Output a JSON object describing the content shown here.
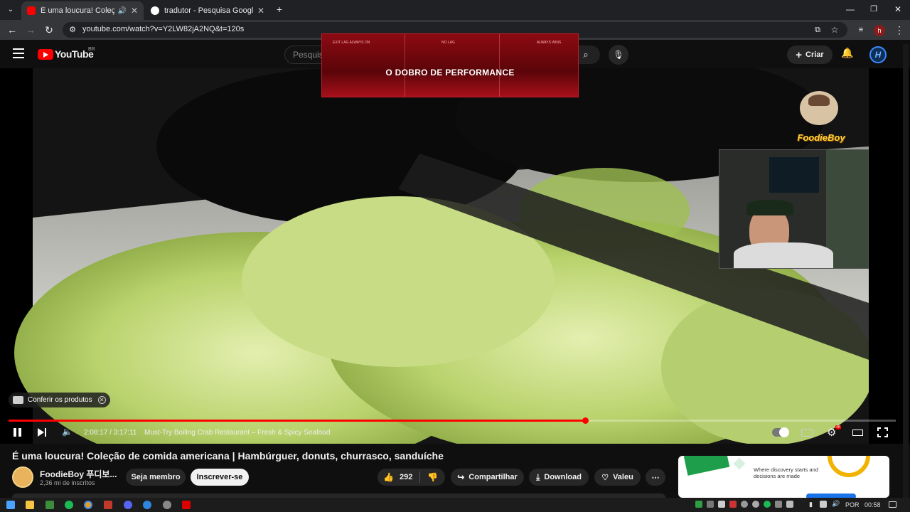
{
  "browser": {
    "tabs": [
      {
        "label": "É uma loucura! Coleção de",
        "active": true
      },
      {
        "label": "tradutor - Pesquisa Google",
        "active": false
      }
    ],
    "url": "youtube.com/watch?v=Y2LW82jA2NQ&t=120s",
    "profile_initial": "h"
  },
  "youtube": {
    "logo_text": "YouTube",
    "region": "BR",
    "search_placeholder": "Pesquis",
    "create_label": "Criar"
  },
  "ad_banner": {
    "top_labels": [
      "EXIT LAG ALWAYS ON",
      "NO LAG",
      "ALWAYS WINS"
    ],
    "headline": "O DOBRO DE PERFORMANCE"
  },
  "overlay": {
    "channel_logo_text": "FoodieBoy"
  },
  "player": {
    "products_label": "Conferir os produtos",
    "time": "2:08:17 / 3:17:11",
    "chapter": "Must-Try Boiling Crab Restaurant – Fresh & Spicy Seafood",
    "progress_fraction": 0.65,
    "quality_badge": "4K"
  },
  "video": {
    "title": "É uma loucura! Coleção de comida americana | Hambúrguer, donuts, churrasco, sanduíche",
    "channel": "FoodieBoy 푸디보...",
    "subscribers": "2,36 mi de inscritos",
    "join_label": "Seja membro",
    "subscribe_label": "Inscrever-se",
    "likes": "292",
    "share_label": "Compartilhar",
    "download_label": "Download",
    "thanks_label": "Valeu"
  },
  "side_ad": {
    "text": "Where discovery starts and decisions are made"
  },
  "taskbar": {
    "language": "POR",
    "time": "00:58"
  },
  "colors": {
    "accent": "#ff0000",
    "background": "#0f0f0f"
  }
}
